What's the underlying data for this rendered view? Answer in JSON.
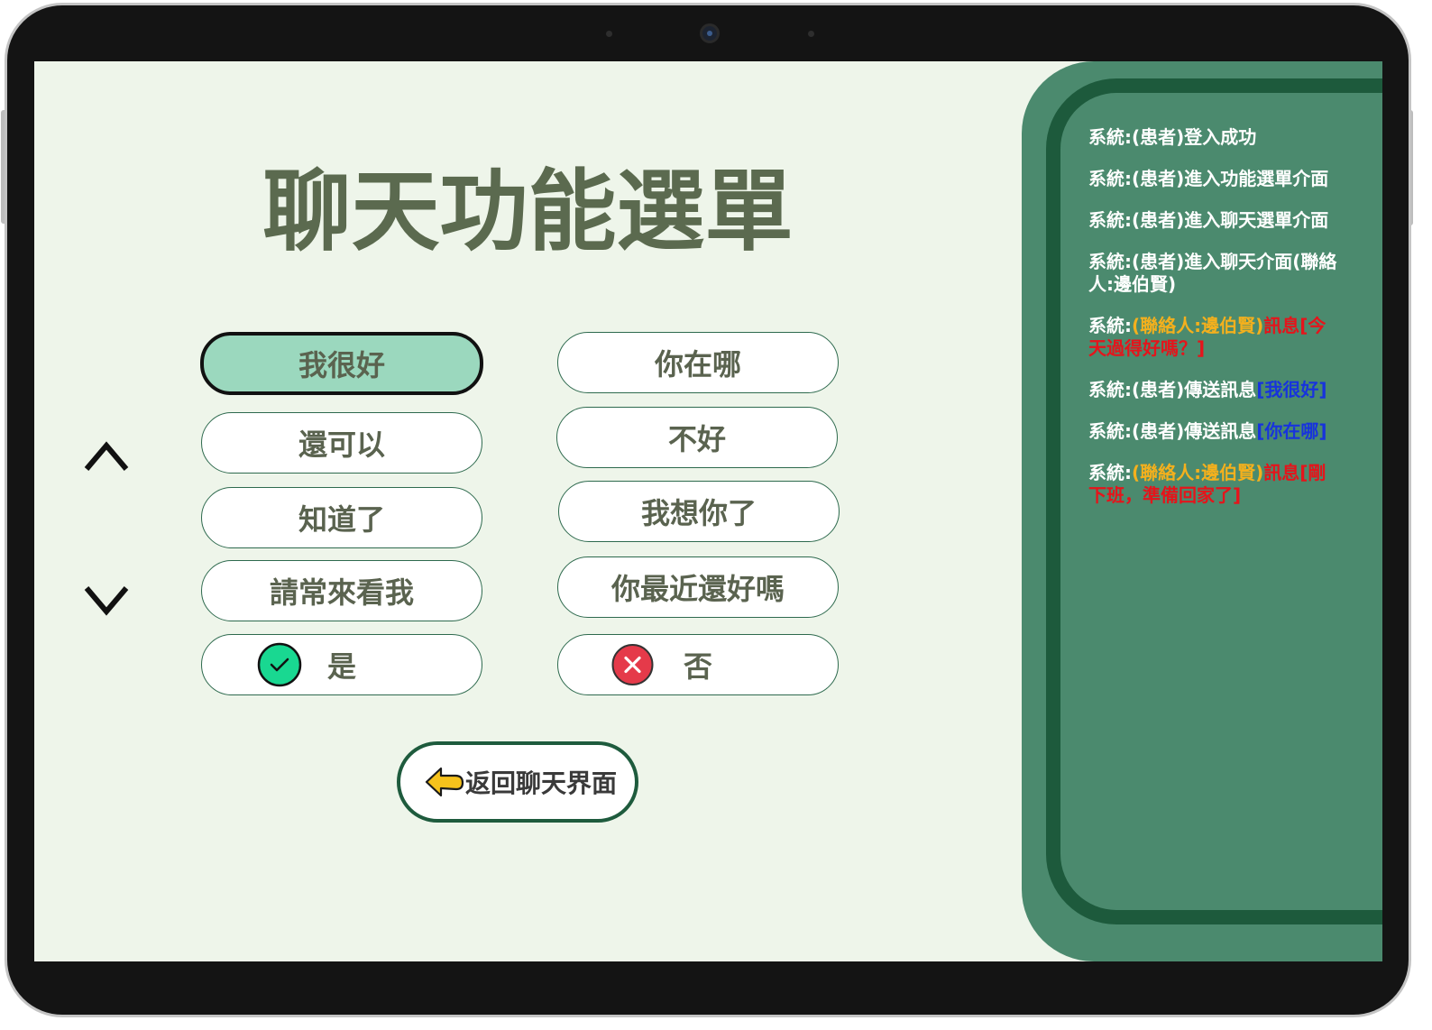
{
  "title": "聊天功能選單",
  "options": {
    "left": [
      {
        "label": "我很好",
        "selected": true
      },
      {
        "label": "還可以",
        "selected": false
      },
      {
        "label": "知道了",
        "selected": false
      },
      {
        "label": "請常來看我",
        "selected": false
      },
      {
        "label": "是",
        "icon": "check-circle-icon",
        "selected": false
      }
    ],
    "right": [
      {
        "label": "你在哪",
        "selected": false
      },
      {
        "label": "不好",
        "selected": false
      },
      {
        "label": "我想你了",
        "selected": false
      },
      {
        "label": "你最近還好嗎",
        "selected": false
      },
      {
        "label": "否",
        "icon": "close-circle-icon",
        "selected": false
      }
    ]
  },
  "nav": {
    "up_icon": "chevron-up-icon",
    "down_icon": "chevron-down-icon"
  },
  "back_button": {
    "label": "返回聊天界面",
    "icon": "arrow-left-icon"
  },
  "log": {
    "entries": [
      {
        "segments": [
          {
            "text": "系統:(患者)登入成功",
            "color": "#ffffff"
          }
        ]
      },
      {
        "segments": [
          {
            "text": "系統:(患者)進入功能選單介面",
            "color": "#ffffff"
          }
        ]
      },
      {
        "segments": [
          {
            "text": "系統:(患者)進入聊天選單介面",
            "color": "#ffffff"
          }
        ]
      },
      {
        "segments": [
          {
            "text": "系統:(患者)進入聊天介面(聯絡人:邊伯賢)",
            "color": "#ffffff"
          }
        ]
      },
      {
        "segments": [
          {
            "text": "系統:",
            "color": "#ffffff"
          },
          {
            "text": "(聯絡人:邊伯賢)",
            "color": "#f4b01d"
          },
          {
            "text": "訊息[今天過得好嗎？]",
            "color": "#e5141b"
          }
        ]
      },
      {
        "segments": [
          {
            "text": "系統:(患者)傳送訊息",
            "color": "#ffffff"
          },
          {
            "text": "[我很好]",
            "color": "#1733dd"
          }
        ]
      },
      {
        "segments": [
          {
            "text": "系統:(患者)傳送訊息",
            "color": "#ffffff"
          },
          {
            "text": "[你在哪]",
            "color": "#1733dd"
          }
        ]
      },
      {
        "segments": [
          {
            "text": "系統:",
            "color": "#ffffff"
          },
          {
            "text": "(聯絡人:邊伯賢)",
            "color": "#f4b01d"
          },
          {
            "text": "訊息[剛下班，準備回家了]",
            "color": "#e5141b"
          }
        ]
      }
    ]
  },
  "theme": {
    "screen-bg": "#eef5ea",
    "title": "#5b6a4f",
    "option-text": "#5a634f",
    "option-border": "#2e6a4e",
    "selected-bg": "#9bd8be",
    "panel-bg": "#4b8a6e",
    "panel-border": "#1d5a3c",
    "back-border": "#1e5b3d",
    "yes-green": "#19d891",
    "no-red": "#e53a4a",
    "arrow-yellow": "#f6c21c"
  }
}
